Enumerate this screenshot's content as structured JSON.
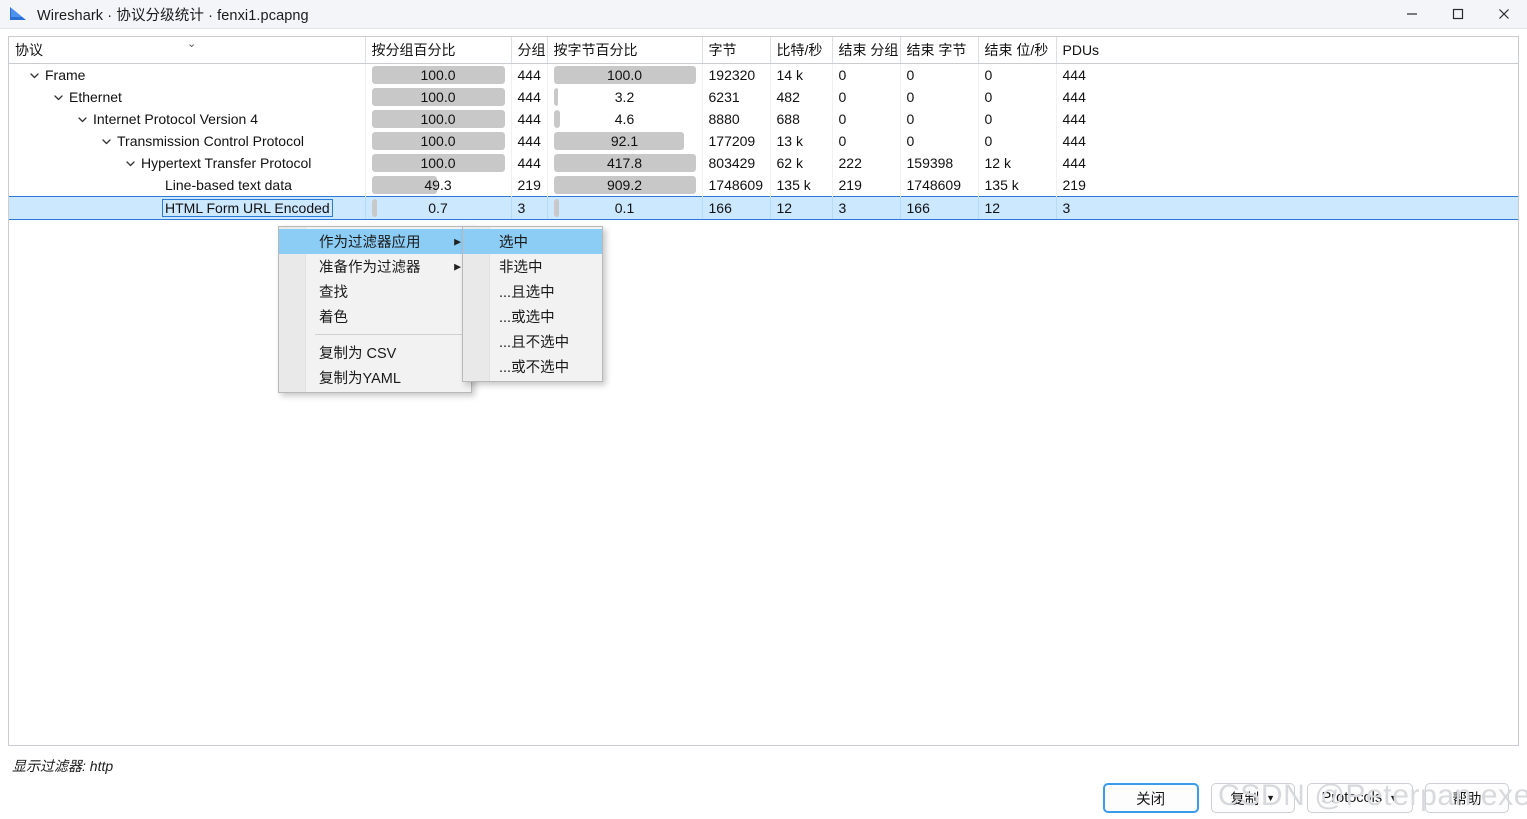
{
  "window": {
    "title": "Wireshark · 协议分级统计 · fenxi1.pcapng",
    "minimize_label": "—",
    "maximize_label": "□",
    "close_label": "✕"
  },
  "table": {
    "columns": [
      {
        "key": "protocol",
        "label": "协议"
      },
      {
        "key": "percent_packets",
        "label": "按分组百分比"
      },
      {
        "key": "packets",
        "label": "分组"
      },
      {
        "key": "percent_bytes",
        "label": "按字节百分比"
      },
      {
        "key": "bytes",
        "label": "字节"
      },
      {
        "key": "bits_per_sec",
        "label": "比特/秒"
      },
      {
        "key": "end_packets",
        "label": "结束 分组"
      },
      {
        "key": "end_bytes",
        "label": "结束 字节"
      },
      {
        "key": "end_bits_per_sec",
        "label": "结束 位/秒"
      },
      {
        "key": "pdus",
        "label": "PDUs"
      }
    ],
    "sort_indicator": "⌄",
    "rows": [
      {
        "protocol": "Frame",
        "depth": 0,
        "expandable": true,
        "percent_packets": "100.0",
        "percent_packets_fill": 100,
        "packets": "444",
        "percent_bytes": "100.0",
        "percent_bytes_fill": 100,
        "bytes": "192320",
        "bits_per_sec": "14 k",
        "end_packets": "0",
        "end_bytes": "0",
        "end_bits_per_sec": "0",
        "pdus": "444",
        "selected": false
      },
      {
        "protocol": "Ethernet",
        "depth": 1,
        "expandable": true,
        "percent_packets": "100.0",
        "percent_packets_fill": 100,
        "packets": "444",
        "percent_bytes": "3.2",
        "percent_bytes_fill": 3.2,
        "bytes": "6231",
        "bits_per_sec": "482",
        "end_packets": "0",
        "end_bytes": "0",
        "end_bits_per_sec": "0",
        "pdus": "444",
        "selected": false
      },
      {
        "protocol": "Internet Protocol Version 4",
        "depth": 2,
        "expandable": true,
        "percent_packets": "100.0",
        "percent_packets_fill": 100,
        "packets": "444",
        "percent_bytes": "4.6",
        "percent_bytes_fill": 4.6,
        "bytes": "8880",
        "bits_per_sec": "688",
        "end_packets": "0",
        "end_bytes": "0",
        "end_bits_per_sec": "0",
        "pdus": "444",
        "selected": false
      },
      {
        "protocol": "Transmission Control Protocol",
        "depth": 3,
        "expandable": true,
        "percent_packets": "100.0",
        "percent_packets_fill": 100,
        "packets": "444",
        "percent_bytes": "92.1",
        "percent_bytes_fill": 92.1,
        "bytes": "177209",
        "bits_per_sec": "13 k",
        "end_packets": "0",
        "end_bytes": "0",
        "end_bits_per_sec": "0",
        "pdus": "444",
        "selected": false
      },
      {
        "protocol": "Hypertext Transfer Protocol",
        "depth": 4,
        "expandable": true,
        "percent_packets": "100.0",
        "percent_packets_fill": 100,
        "packets": "444",
        "percent_bytes": "417.8",
        "percent_bytes_fill": 100,
        "bytes": "803429",
        "bits_per_sec": "62 k",
        "end_packets": "222",
        "end_bytes": "159398",
        "end_bits_per_sec": "12 k",
        "pdus": "444",
        "selected": false
      },
      {
        "protocol": "Line-based text data",
        "depth": 5,
        "expandable": false,
        "percent_packets": "49.3",
        "percent_packets_fill": 49.3,
        "packets": "219",
        "percent_bytes": "909.2",
        "percent_bytes_fill": 100,
        "bytes": "1748609",
        "bits_per_sec": "135 k",
        "end_packets": "219",
        "end_bytes": "1748609",
        "end_bits_per_sec": "135 k",
        "pdus": "219",
        "selected": false
      },
      {
        "protocol": "HTML Form URL Encoded",
        "depth": 5,
        "expandable": false,
        "percent_packets": "0.7",
        "percent_packets_fill": 0.7,
        "packets": "3",
        "percent_bytes": "0.1",
        "percent_bytes_fill": 0.1,
        "bytes": "166",
        "bits_per_sec": "12",
        "end_packets": "3",
        "end_bytes": "166",
        "end_bits_per_sec": "12",
        "pdus": "3",
        "selected": true
      }
    ]
  },
  "context_menu": {
    "items": [
      {
        "label": "作为过滤器应用",
        "submenu": true,
        "highlight": true
      },
      {
        "label": "准备作为过滤器",
        "submenu": true,
        "highlight": false
      },
      {
        "label": "查找",
        "submenu": false,
        "highlight": false
      },
      {
        "label": "着色",
        "submenu": false,
        "highlight": false
      },
      {
        "separator": true
      },
      {
        "label": "复制为 CSV",
        "submenu": false,
        "highlight": false
      },
      {
        "label": "复制为YAML",
        "submenu": false,
        "highlight": false
      }
    ],
    "submenu_arrow": "▶"
  },
  "submenu": {
    "items": [
      {
        "label": "选中",
        "highlight": true
      },
      {
        "label": "非选中",
        "highlight": false
      },
      {
        "label": "...且选中",
        "highlight": false
      },
      {
        "label": "...或选中",
        "highlight": false
      },
      {
        "label": "...且不选中",
        "highlight": false
      },
      {
        "label": "...或不选中",
        "highlight": false
      }
    ]
  },
  "footer": {
    "display_filter": "显示过滤器: http",
    "close_label": "关闭",
    "copy_label": "复制",
    "protocols_label": "Protocols",
    "help_label": "帮助",
    "caret": "▼",
    "watermark": "CSDN @Peterpan.exe"
  },
  "colors": {
    "accent": "#3c9ae8",
    "selection": "#cce8ff",
    "selection_border": "#2d7bd4",
    "menu_highlight": "#8ccdf5",
    "bar": "#c8c8c8",
    "titlebar": "#f3f5f8"
  }
}
